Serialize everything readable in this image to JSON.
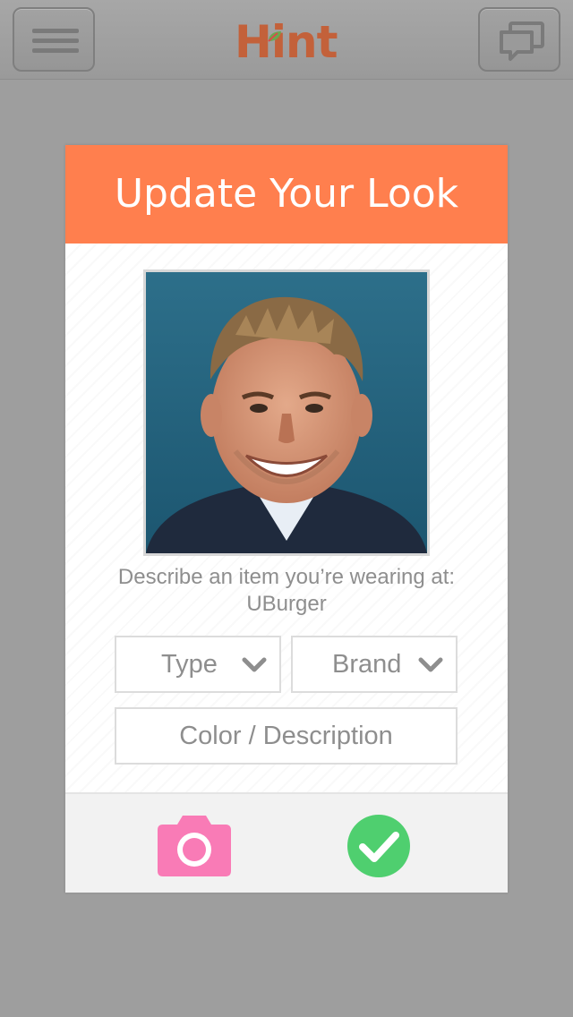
{
  "app": {
    "logo_text": "Hint"
  },
  "topbar": {
    "menu_icon": "hamburger-menu-icon",
    "chat_icon": "chat-bubbles-icon"
  },
  "card": {
    "title": "Update Your Look",
    "prompt_line1": "Describe an item you’re wearing at:",
    "prompt_line2": "UBurger",
    "type_select": {
      "label": "Type"
    },
    "brand_select": {
      "label": "Brand"
    },
    "description_field": {
      "placeholder": "Color / Description"
    },
    "footer": {
      "camera_icon": "camera-icon",
      "confirm_icon": "checkmark-icon"
    }
  },
  "colors": {
    "header_orange": "#ff7f4e",
    "logo_color": "#c3613a",
    "camera_pink": "#f97bb6",
    "confirm_green": "#4fcf6f",
    "background_gray": "#9e9e9e"
  }
}
